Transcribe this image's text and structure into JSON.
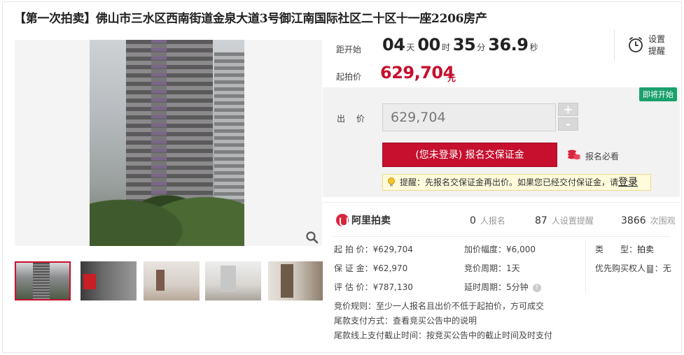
{
  "title": {
    "tag": "【第一次拍卖】",
    "text": "佛山市三水区西南街道金泉大道3号御江南国际社区二十区十一座2206房产"
  },
  "countdown": {
    "label": "距开始",
    "days": "04",
    "days_unit": "天",
    "hours": "00",
    "hours_unit": "时",
    "minutes": "35",
    "minutes_unit": "分",
    "seconds": "36.9",
    "seconds_unit": "秒"
  },
  "reminder": {
    "label": "设置提醒"
  },
  "start_price": {
    "label": "起拍价",
    "value": "629,704",
    "unit": "元"
  },
  "bid": {
    "badge": "即将开始",
    "label": "出 价",
    "input_value": "629,704",
    "plus": "+",
    "minus": "-",
    "signup_button": "(您未登录) 报名交保证金",
    "must_label": "报名必看",
    "tip_text": "提醒：先报名交保证金再出价。如果您已经交付保证金，请",
    "tip_login": "登录"
  },
  "stats": {
    "logo": "阿里拍卖",
    "signups_count": "0",
    "signups_label": "人报名",
    "reminders_count": "87",
    "reminders_label": "人设置提醒",
    "views_count": "3866",
    "views_label": "次围观"
  },
  "details": {
    "start_price": {
      "key": "起 拍 价：",
      "value": "¥629,704"
    },
    "deposit": {
      "key": "保 证 金：",
      "value": "¥62,970"
    },
    "appraisal": {
      "key": "评 估 价：",
      "value": "¥787,130"
    },
    "increment": {
      "key": "加价幅度：",
      "value": "¥6,000"
    },
    "bid_cycle": {
      "key": "竞价周期：",
      "value": "1天"
    },
    "extension": {
      "key": "延时周期：",
      "value": "5分钟"
    },
    "type": {
      "key": "类　　型：",
      "value": "拍卖"
    },
    "priority_buyer": {
      "key": "优先购买权人",
      "icon_text": "?",
      "value": "：无"
    },
    "rules": {
      "key": "竞价规则：",
      "value": "至少一人报名且出价不低于起拍价，方可成交"
    },
    "payment_method": {
      "key": "尾款支付方式：",
      "value": "查看竞买公告中的说明"
    },
    "payment_deadline": {
      "key": "尾款线上支付截止时间：",
      "value": "按竞买公告中的截止时间及时支付"
    }
  },
  "colors": {
    "accent": "#c6102e",
    "badge": "#1aa06d"
  }
}
